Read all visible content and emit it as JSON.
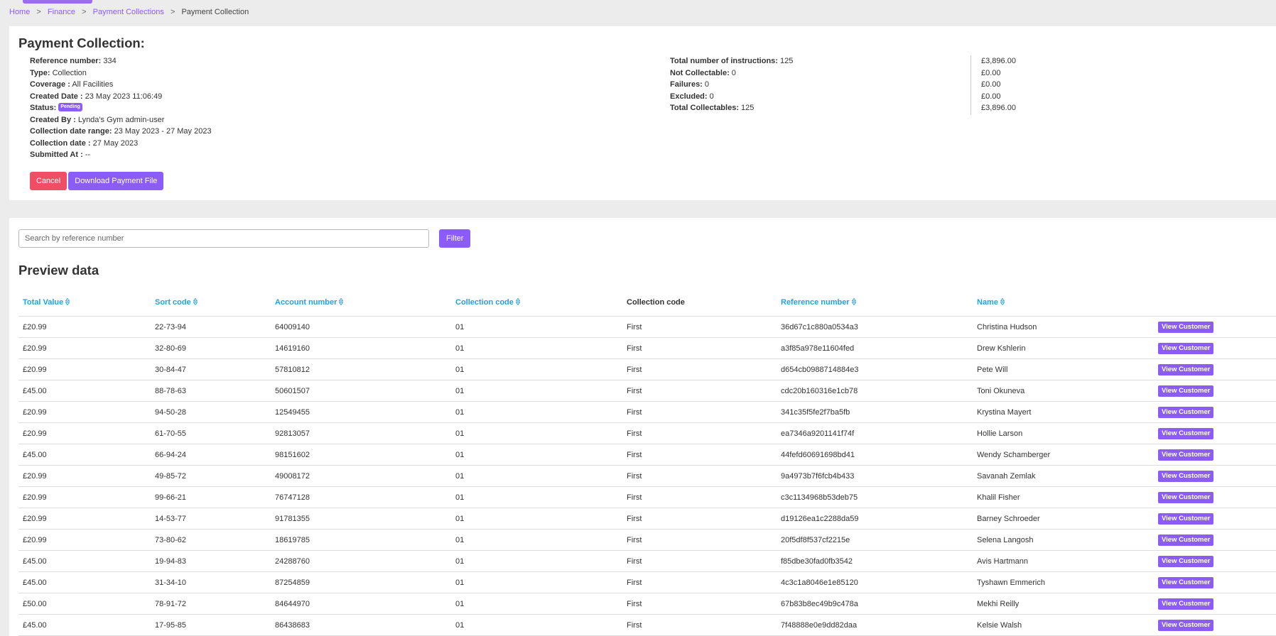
{
  "breadcrumb": {
    "items": [
      "Home",
      "Finance",
      "Payment Collections"
    ],
    "separator": ">",
    "current": "Payment Collection"
  },
  "details": {
    "title": "Payment Collection:",
    "fields": [
      {
        "label": "Reference number:",
        "value": "334"
      },
      {
        "label": "Type:",
        "value": "Collection"
      },
      {
        "label": "Coverage :",
        "value": "All Facilities"
      },
      {
        "label": "Created Date :",
        "value": "23 May 2023 11:06:49"
      },
      {
        "label": "Status:",
        "badge": "Pending"
      },
      {
        "label": "Created By :",
        "value": "Lynda's Gym admin-user"
      },
      {
        "label": "Collection date range:",
        "value": "23 May 2023 - 27 May 2023"
      },
      {
        "label": "Collection date :",
        "value": "27 May 2023"
      },
      {
        "label": "Submitted At :",
        "value": "--"
      }
    ],
    "stats": [
      {
        "label": "Total number of instructions:",
        "value": "125"
      },
      {
        "label": "Not Collectable:",
        "value": "0"
      },
      {
        "label": "Failures:",
        "value": "0"
      },
      {
        "label": "Excluded:",
        "value": "0"
      },
      {
        "label": "Total Collectables:",
        "value": "125"
      }
    ],
    "amounts": [
      "£3,896.00",
      "£0.00",
      "£0.00",
      "£0.00",
      "£3,896.00"
    ],
    "cancel_label": "Cancel",
    "download_label": "Download Payment File"
  },
  "search": {
    "placeholder": "Search by reference number",
    "filter_label": "Filter"
  },
  "preview": {
    "title": "Preview data",
    "columns": [
      "Total Value",
      "Sort code",
      "Account number",
      "Collection code",
      "Collection code",
      "Reference number",
      "Name"
    ],
    "view_label": "View Customer",
    "rows": [
      [
        "£20.99",
        "22-73-94",
        "64009140",
        "01",
        "First",
        "36d67c1c880a0534a3",
        "Christina Hudson"
      ],
      [
        "£20.99",
        "32-80-69",
        "14619160",
        "01",
        "First",
        "a3f85a978e11604fed",
        "Drew Kshlerin"
      ],
      [
        "£20.99",
        "30-84-47",
        "57810812",
        "01",
        "First",
        "d654cb0988714884e3",
        "Pete Will"
      ],
      [
        "£45.00",
        "88-78-63",
        "50601507",
        "01",
        "First",
        "cdc20b160316e1cb78",
        "Toni Okuneva"
      ],
      [
        "£20.99",
        "94-50-28",
        "12549455",
        "01",
        "First",
        "341c35f5fe2f7ba5fb",
        "Krystina Mayert"
      ],
      [
        "£20.99",
        "61-70-55",
        "92813057",
        "01",
        "First",
        "ea7346a9201141f74f",
        "Hollie Larson"
      ],
      [
        "£45.00",
        "66-94-24",
        "98151602",
        "01",
        "First",
        "44fefd60691698bd41",
        "Wendy Schamberger"
      ],
      [
        "£20.99",
        "49-85-72",
        "49008172",
        "01",
        "First",
        "9a4973b7f6fcb4b433",
        "Savanah Zemlak"
      ],
      [
        "£20.99",
        "99-66-21",
        "76747128",
        "01",
        "First",
        "c3c1134968b53deb75",
        "Khalil Fisher"
      ],
      [
        "£20.99",
        "14-53-77",
        "91781355",
        "01",
        "First",
        "d19126ea1c2288da59",
        "Barney Schroeder"
      ],
      [
        "£20.99",
        "73-80-62",
        "18619785",
        "01",
        "First",
        "20f5df8f537cf2215e",
        "Selena Langosh"
      ],
      [
        "£45.00",
        "19-94-83",
        "24288760",
        "01",
        "First",
        "f85dbe30fad0fb3542",
        "Avis Hartmann"
      ],
      [
        "£45.00",
        "31-34-10",
        "87254859",
        "01",
        "First",
        "4c3c1a8046e1e85120",
        "Tyshawn Emmerich"
      ],
      [
        "£50.00",
        "78-91-72",
        "84644970",
        "01",
        "First",
        "67b83b8ec49b9c478a",
        "Mekhi Reilly"
      ],
      [
        "£45.00",
        "17-95-85",
        "86438683",
        "01",
        "First",
        "7f48888e0e9dd82daa",
        "Kelsie Walsh"
      ]
    ]
  }
}
